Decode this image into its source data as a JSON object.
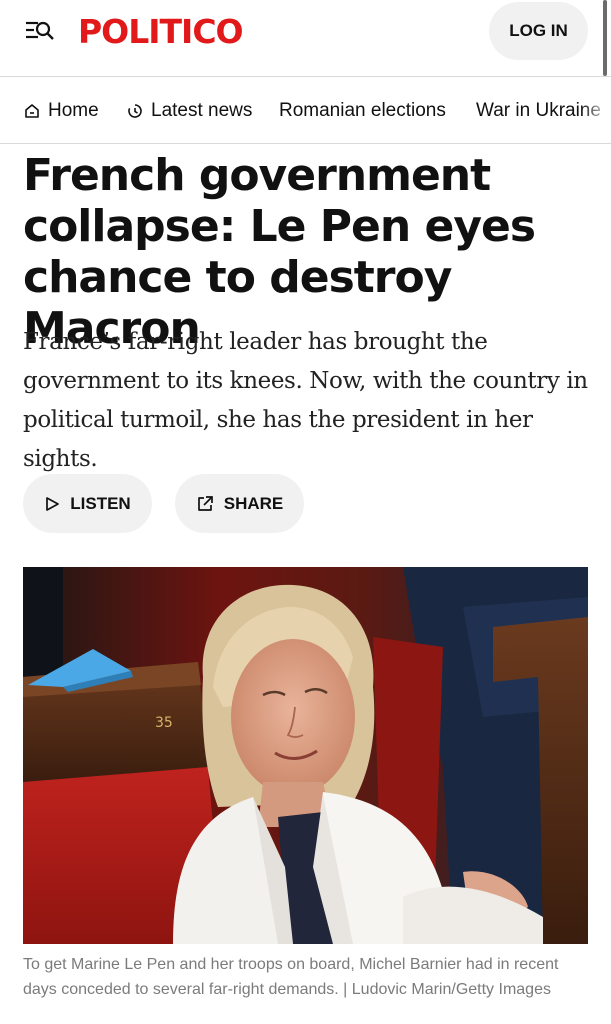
{
  "header": {
    "logo": "POLITICO",
    "login_label": "LOG IN",
    "menu_icon": "menu-search-icon"
  },
  "nav": {
    "items": [
      {
        "label": "Home",
        "icon": "home-icon"
      },
      {
        "label": "Latest news",
        "icon": "clock-icon"
      },
      {
        "label": "Romanian elections"
      },
      {
        "label": "War in Ukraine"
      }
    ]
  },
  "article": {
    "headline_lines": [
      "French government",
      "collapse: Le Pen eyes",
      "chance to destroy Macron"
    ],
    "dek_lines": [
      "France’s far-right leader has brought the",
      "government to its knees. Now, with the country in",
      "political turmoil, she has the president in her sights."
    ],
    "listen_label": "LISTEN",
    "share_label": "SHARE",
    "image": {
      "seat_number": "35",
      "caption_lines": [
        "To get Marine Le Pen and her troops on board, Michel Barnier had in recent",
        "days conceded to several far-right demands. | Ludovic Marin/Getty Images"
      ]
    }
  },
  "colors": {
    "brand_red": "#e2191b",
    "pill_bg": "#f1f1f1",
    "caption_gray": "#7b7b7b"
  }
}
